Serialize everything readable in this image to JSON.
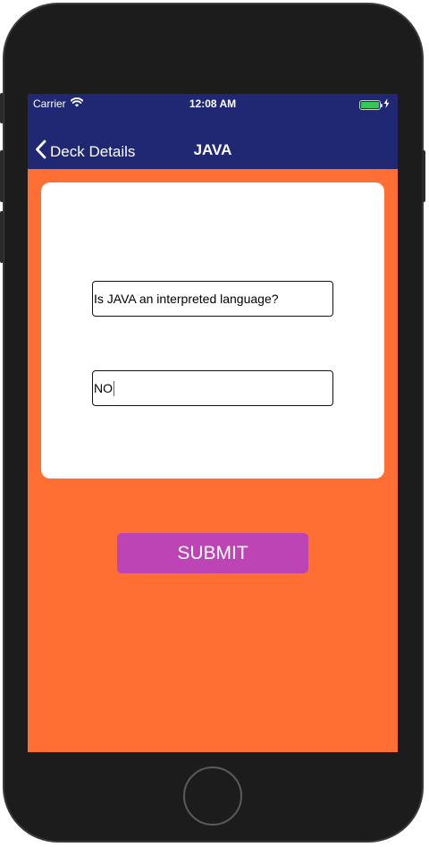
{
  "status_bar": {
    "carrier": "Carrier",
    "time": "12:08 AM",
    "battery_level": 1.0,
    "wifi_icon": "wifi-icon",
    "battery_icon": "battery-icon",
    "charging_icon": "charging-bolt-icon"
  },
  "nav": {
    "back_label": "Deck Details",
    "back_icon": "chevron-left-icon",
    "title": "JAVA"
  },
  "form": {
    "question_value": "Is JAVA an interpreted language?",
    "answer_value": "NO"
  },
  "actions": {
    "submit_label": "SUBMIT"
  },
  "colors": {
    "nav_background": "#212873",
    "screen_background": "#ff6e33",
    "submit_background": "#bd44b5",
    "card_background": "#ffffff"
  }
}
